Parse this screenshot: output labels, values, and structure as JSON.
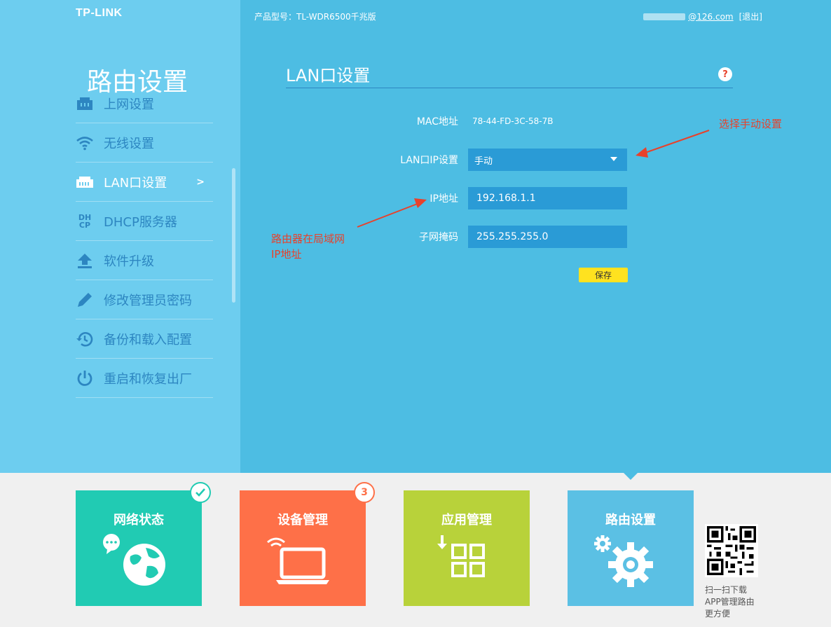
{
  "header": {
    "logo": "TP-LINK",
    "model_label": "产品型号：TL-WDR6500千兆版",
    "email_suffix": "@126.com",
    "logout_label": "[退出]"
  },
  "sidebar": {
    "title": "路由设置",
    "items": [
      {
        "label": "上网设置",
        "icon": "network-port-icon"
      },
      {
        "label": "无线设置",
        "icon": "wifi-icon"
      },
      {
        "label": "LAN口设置",
        "icon": "lan-port-icon",
        "active": true,
        "arrow": ">"
      },
      {
        "label": "DHCP服务器",
        "icon": "dhcp-icon",
        "icon_text": "DH CP"
      },
      {
        "label": "软件升级",
        "icon": "upload-icon"
      },
      {
        "label": "修改管理员密码",
        "icon": "pencil-icon"
      },
      {
        "label": "备份和载入配置",
        "icon": "history-icon"
      },
      {
        "label": "重启和恢复出厂",
        "icon": "power-icon"
      }
    ]
  },
  "form": {
    "title": "LAN口设置",
    "help_glyph": "?",
    "mac_label": "MAC地址",
    "mac_value": "78-44-FD-3C-58-7B",
    "mode_label": "LAN口IP设置",
    "mode_value": "手动",
    "ip_label": "IP地址",
    "ip_value": "192.168.1.1",
    "mask_label": "子网掩码",
    "mask_value": "255.255.255.0",
    "save_label": "保存"
  },
  "annotations": {
    "select_manual": "选择手动设置",
    "lan_ip_line1": "路由器在局域网",
    "lan_ip_line2": "IP地址"
  },
  "tiles": [
    {
      "label": "网络状态",
      "color": "#21cbb3",
      "badge": "check-icon"
    },
    {
      "label": "设备管理",
      "color": "#fe7048",
      "badge_text": "3"
    },
    {
      "label": "应用管理",
      "color": "#b8d23a"
    },
    {
      "label": "路由设置",
      "color": "#5bc0e4",
      "active": true
    }
  ],
  "qr": {
    "line1": "扫一扫下载",
    "line2": "APP管理路由",
    "line3": "更方便"
  },
  "colors": {
    "left_panel": "#6dcdef",
    "right_panel": "#4dbde3",
    "field": "#2a9bd6",
    "menu_text": "#2d86c1",
    "annotation": "#e8412b",
    "save_button": "#ffe21f"
  }
}
